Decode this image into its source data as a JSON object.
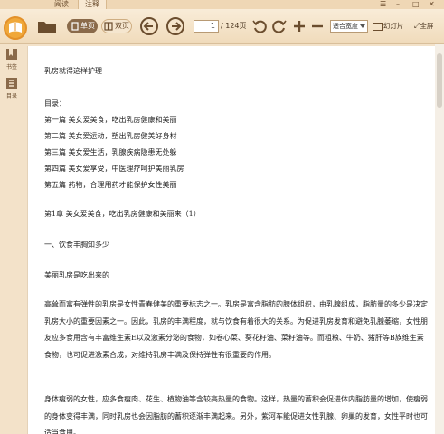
{
  "tabs": [
    {
      "label": "阅读"
    },
    {
      "label": "注释"
    }
  ],
  "toolbar": {
    "single_label": "单页",
    "double_label": "双页",
    "page_current": "1",
    "page_total": "/ 124页",
    "zoom_select": "适合宽度",
    "slideshow_label": "幻灯片",
    "fullscreen_label": "全屏"
  },
  "sidebar": {
    "items": [
      {
        "label": "书签"
      },
      {
        "label": "目录"
      }
    ]
  },
  "doc": {
    "title": "乳房就得这样护理",
    "toc_heading": "目录：",
    "toc": [
      "第一篇  美女爱美食，吃出乳房健康和美丽",
      "第二篇  美女爱运动，塑出乳房健美好身材",
      "第三篇  美女爱生活，乳腺疾病隐患无处躲",
      "第四篇  美女爱享受，中医理疗呵护美丽乳房",
      "第五篇  药物，合理用药才能保护女性美丽"
    ],
    "chapter": "第1章  美女爱美食，吃出乳房健康和美丽来（1）",
    "section": "一、饮食丰胸知多少",
    "subsection": "美丽乳房是吃出来的",
    "para1": "    高耸而富有弹性的乳房是女性青春健美的重要标志之一。乳房是富含脂肪的腺体组织，由乳腺组成，脂肪量的多少是决定乳房大小的重要因素之一。因此，乳房的丰满程度，就与饮食有着很大的关系。为促进乳房发育和避免乳腺萎缩，女性朋友应多食用含有丰富维生素E以及激素分泌的食物，如卷心菜、葵花籽油、菜籽油等。而粗粮、牛奶、猪肝等B族维生素食物，也可促进激素合成，对维持乳房丰满及保持弹性有很重要的作用。",
    "para2": "    身体瘦弱的女性，应多食瘦肉、花生、植物油等含较高热量的食物。这样，热量的蓄积会促进体内脂肪量的增加，使瘦弱的身体变得丰满，同时乳房也会因脂肪的蓄积逐渐丰满起来。另外，紫河车能促进女性乳腺、卵巢的发育，女性平时也可适当食用。"
  },
  "colors": {
    "accent": "#6b4d2e",
    "toolbar_bg": "#f3e2c9",
    "logo": "#f0a83a"
  }
}
